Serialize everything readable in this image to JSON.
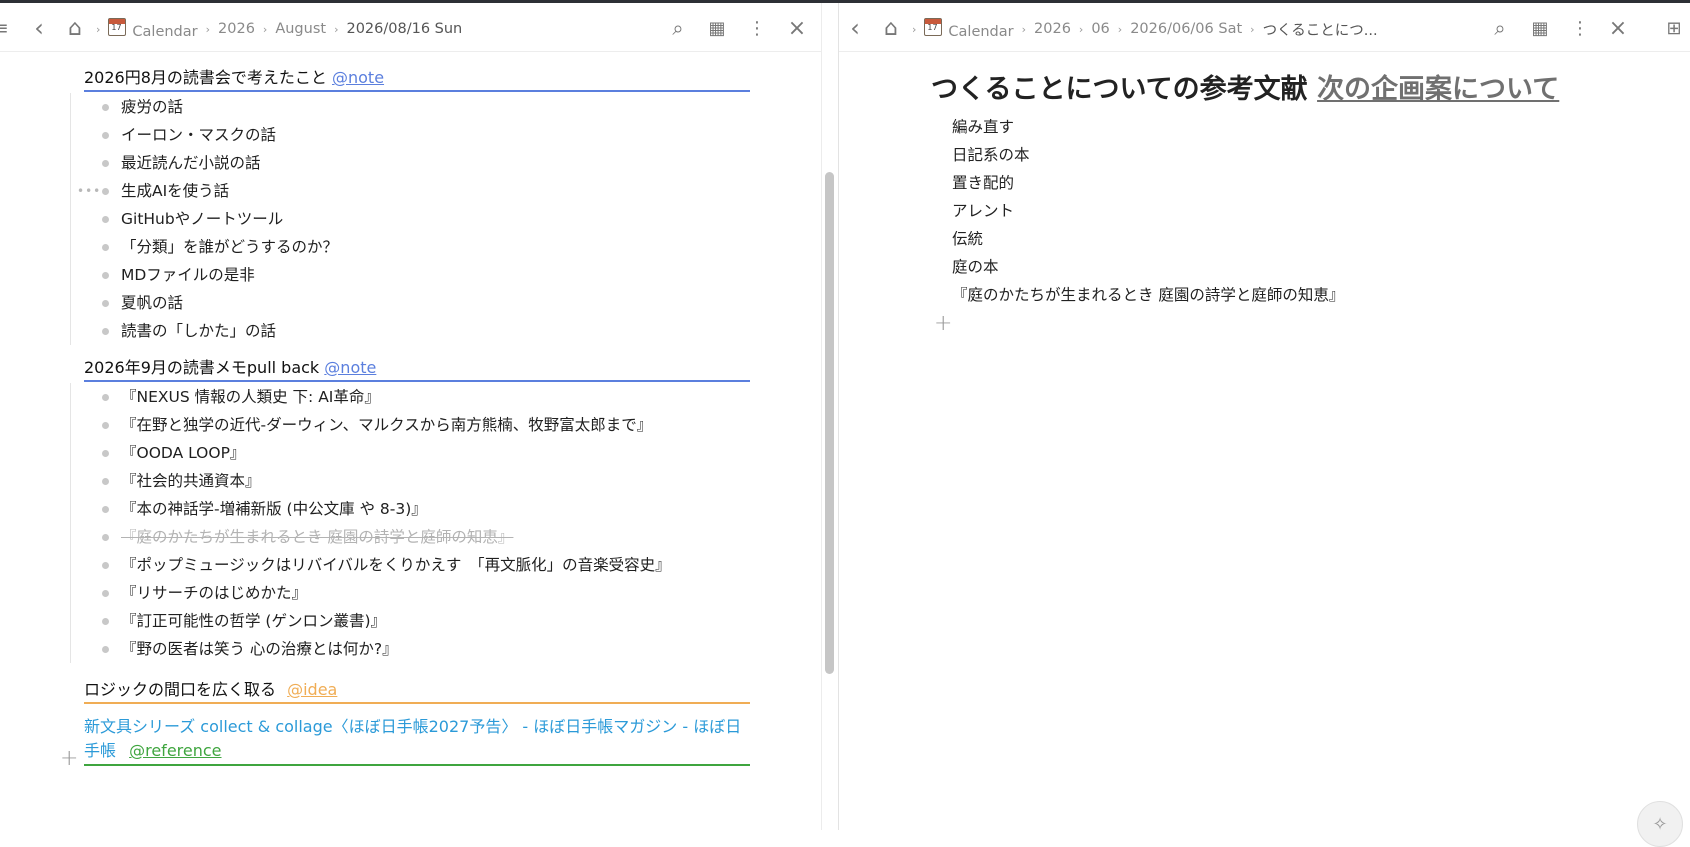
{
  "left": {
    "breadcrumb": [
      {
        "label": "Calendar",
        "has_icon": true
      },
      {
        "label": "2026"
      },
      {
        "label": "August"
      },
      {
        "label": "2026/08/16 Sun",
        "current": true
      }
    ],
    "sections": [
      {
        "title": "2026円8月の読書会で考えたこと",
        "tag": "@note",
        "tag_color": "#5b7fde",
        "items": [
          "疲労の話",
          "イーロン・マスクの話",
          "最近読んだ小説の話",
          "生成AIを使う話",
          "GitHubやノートツール",
          "「分類」を誰がどうするのか？",
          "MDファイルの是非",
          "夏帆の話",
          "読書の「しかた」の話"
        ]
      },
      {
        "title": "2026年9月の読書メモpull back",
        "tag": "@note",
        "tag_color": "#5b7fde",
        "items": [
          "『NEXUS 情報の人類史 下: AI革命』",
          "『在野と独学の近代-ダーウィン、マルクスから南方熊楠、牧野富太郎まで』",
          "『OODA LOOP』",
          "『社会的共通資本』",
          "『本の神話学-増補新版 (中公文庫 や 8-3)』",
          "『庭のかたちが生まれるとき 庭園の詩学と庭師の知恵』",
          "『ポップミュージックはリバイバルをくりかえす　「再文脈化」の音楽受容史』",
          "『リサーチのはじめかた』",
          "『訂正可能性の哲学 (ゲンロン叢書)』",
          "『野の医者は笑う 心の治療とは何か?』"
        ],
        "struck_index": 5
      },
      {
        "title": "ロジックの間口を広く取る",
        "tag": "@idea",
        "tag_color": "#f0ad55"
      }
    ],
    "link": {
      "text": "新文具シリーズ collect & collage〈ほぼ日手帳2027予告〉 - ほぼ日手帳マガジン - ほぼ日手帳",
      "tag": "@reference",
      "tag_color": "#3fa53f"
    }
  },
  "right": {
    "breadcrumb": [
      {
        "label": "Calendar",
        "has_icon": true
      },
      {
        "label": "2026"
      },
      {
        "label": "06"
      },
      {
        "label": "2026/06/06 Sat"
      },
      {
        "label": "つくることにつ...",
        "current": true
      }
    ],
    "title": "つくることについての参考文献",
    "title_link": "次の企画案について",
    "items": [
      "編み直す",
      "日記系の本",
      "置き配的",
      "アレント",
      "伝統",
      "庭の本",
      "『庭のかたちが生まれるとき 庭園の詩学と庭師の知恵』"
    ]
  },
  "icons": {
    "menu": "≡",
    "back": "‹",
    "home": "⌂",
    "chevron": "›",
    "search": "⌕",
    "calendar": "▦",
    "more": "⋮",
    "close": "×",
    "add": "+",
    "drag": "•••",
    "new_pane": "⊞",
    "sparkle": "✧"
  },
  "colors": {
    "note": "#5b7fde",
    "idea": "#f0ad55",
    "reference": "#3fa53f",
    "link": "#2b9ad8"
  }
}
